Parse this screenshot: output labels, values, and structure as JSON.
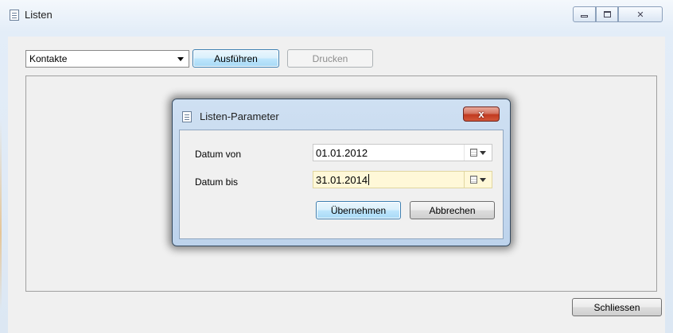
{
  "window": {
    "title": "Listen",
    "controls": {
      "minimize": "minimize",
      "maximize": "maximize",
      "close": "✕"
    }
  },
  "toolbar": {
    "list_select": {
      "value": "Kontakte"
    },
    "run_label": "Ausführen",
    "print_label": "Drucken"
  },
  "footer": {
    "close_label": "Schliessen"
  },
  "dialog": {
    "title": "Listen-Parameter",
    "close_glyph": "x",
    "fields": {
      "from_label": "Datum von",
      "from_value": "01.01.2012",
      "to_label": "Datum bis",
      "to_value": "31.01.2014"
    },
    "ok_label": "Übernehmen",
    "cancel_label": "Abbrechen"
  },
  "icons": [
    "list-window-icon",
    "minimize-icon",
    "maximize-icon",
    "close-icon",
    "dropdown-arrow-icon",
    "calendar-icon"
  ],
  "colors": {
    "primary_button_border": "#3c7fb1",
    "focused_field": "#fff8d8",
    "dialog_close": "#c23a20"
  }
}
